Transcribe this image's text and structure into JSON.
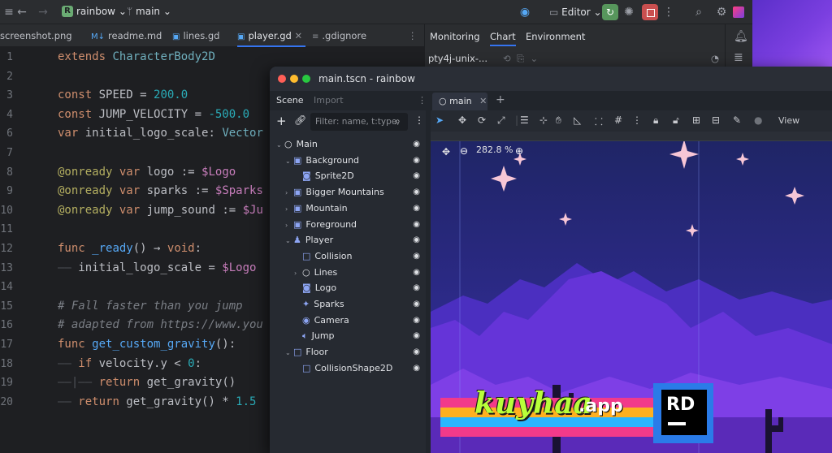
{
  "topbar": {
    "project": "rainbow",
    "project_initial": "R",
    "branch": "main",
    "editor_mode": "Editor"
  },
  "tabs": [
    "screenshot.png",
    "readme.md",
    "lines.gd",
    "player.gd",
    ".gdignore"
  ],
  "tool_panel": {
    "tabs": [
      "Monitoring",
      "Chart",
      "Environment"
    ],
    "process": "pty4j-unix-..."
  },
  "code_lines": [
    {
      "n": "1",
      "html": "<span class='kw'>extends</span> <span class='ty'>CharacterBody2D</span>"
    },
    {
      "n": "2",
      "html": ""
    },
    {
      "n": "3",
      "html": "<span class='kw'>const</span> SPEED = <span class='num'>200.0</span>"
    },
    {
      "n": "4",
      "html": "<span class='kw'>const</span> JUMP_VELOCITY = <span class='num'>-500.0</span>"
    },
    {
      "n": "6",
      "html": "<span class='kw'>var</span> initial_logo_scale: <span class='ty'>Vector</span>"
    },
    {
      "n": "7",
      "html": ""
    },
    {
      "n": "8",
      "html": "<span class='ann'>@onready</span> <span class='kw'>var</span> logo := <span class='node'>$Logo</span>"
    },
    {
      "n": "9",
      "html": "<span class='ann'>@onready</span> <span class='kw'>var</span> sparks := <span class='node'>$Sparks</span>"
    },
    {
      "n": "10",
      "html": "<span class='ann'>@onready</span> <span class='kw'>var</span> jump_sound := <span class='node'>$Ju</span>"
    },
    {
      "n": "11",
      "html": ""
    },
    {
      "n": "12",
      "html": "<span class='kw'>func</span> <span class='fn'>_ready</span>() → <span class='kw'>void</span>:"
    },
    {
      "n": "13",
      "html": "<span class='guide'>——</span> initial_logo_scale = <span class='node'>$Logo</span>"
    },
    {
      "n": "14",
      "html": ""
    },
    {
      "n": "15",
      "html": "<span class='cm'># Fall faster than you jump</span>"
    },
    {
      "n": "16",
      "html": "<span class='cm'># adapted from https://www.you</span>"
    },
    {
      "n": "17",
      "html": "<span class='kw'>func</span> <span class='fn'>get_custom_gravity</span>():"
    },
    {
      "n": "18",
      "html": "<span class='guide'>——</span> <span class='kw'>if</span> velocity.y &lt; <span class='num'>0</span>:"
    },
    {
      "n": "19",
      "html": "<span class='guide'>——</span><span class='guide'>|——</span> <span class='kw'>return</span> get_gravity()"
    },
    {
      "n": "20",
      "html": "<span class='guide'>——</span> <span class='kw'>return</span> get_gravity() * <span class='num'>1.5</span>"
    }
  ],
  "godot": {
    "title": "main.tscn - rainbow",
    "dock_tabs": [
      "Scene",
      "Import"
    ],
    "filter_placeholder": "Filter: name, t:type,",
    "viewport_tab": "main",
    "zoom": "282.8 %",
    "view_label": "View",
    "tree": [
      {
        "label": "Main",
        "indent": 0,
        "arrow": "down",
        "icon": "circle"
      },
      {
        "label": "Background",
        "indent": 1,
        "arrow": "down",
        "icon": "layer"
      },
      {
        "label": "Sprite2D",
        "indent": 2,
        "arrow": "",
        "icon": "sprite"
      },
      {
        "label": "Bigger Mountains",
        "indent": 1,
        "arrow": "right",
        "icon": "layer"
      },
      {
        "label": "Mountain",
        "indent": 1,
        "arrow": "right",
        "icon": "layer"
      },
      {
        "label": "Foreground",
        "indent": 1,
        "arrow": "right",
        "icon": "layer"
      },
      {
        "label": "Player",
        "indent": 1,
        "arrow": "down",
        "icon": "player"
      },
      {
        "label": "Collision",
        "indent": 2,
        "arrow": "",
        "icon": "box"
      },
      {
        "label": "Lines",
        "indent": 2,
        "arrow": "right",
        "icon": "circle"
      },
      {
        "label": "Logo",
        "indent": 2,
        "arrow": "",
        "icon": "sprite"
      },
      {
        "label": "Sparks",
        "indent": 2,
        "arrow": "",
        "icon": "particles"
      },
      {
        "label": "Camera",
        "indent": 2,
        "arrow": "",
        "icon": "camera"
      },
      {
        "label": "Jump",
        "indent": 2,
        "arrow": "",
        "icon": "audio"
      },
      {
        "label": "Floor",
        "indent": 1,
        "arrow": "down",
        "icon": "box"
      },
      {
        "label": "CollisionShape2D",
        "indent": 2,
        "arrow": "",
        "icon": "box"
      }
    ]
  },
  "watermark": {
    "brand": "kuyhaa",
    "suffix": ".app",
    "badge": "RD"
  },
  "colors": {
    "accent": "#3574f0",
    "sky_top": "#2b2a8e",
    "mountain_front": "#6b2fd6",
    "star": "#f7c6d6"
  }
}
